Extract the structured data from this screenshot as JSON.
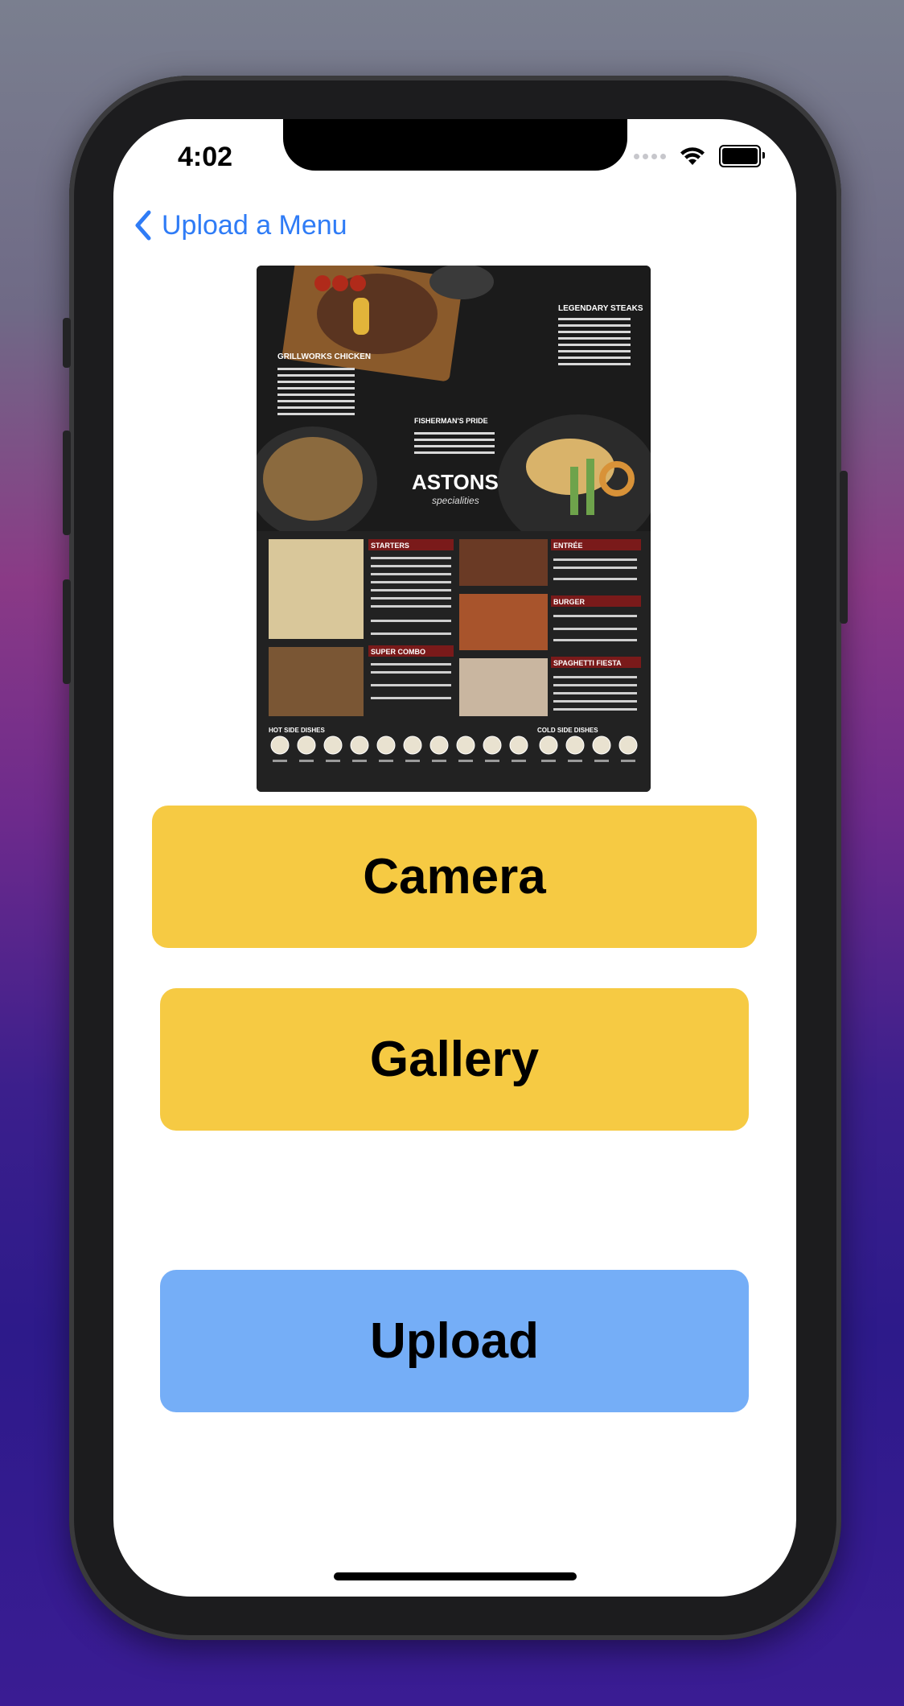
{
  "status_bar": {
    "time": "4:02"
  },
  "navigation": {
    "back_label": "Upload a Menu"
  },
  "menu_image": {
    "brand": "ASTONS",
    "brand_sub": "specialities",
    "sections": {
      "legendary_steaks": "LEGENDARY STEAKS",
      "grillworks_chicken": "GRILLWORKS CHICKEN",
      "fishermans_pride": "FISHERMAN'S PRIDE",
      "starters": "STARTERS",
      "entree": "ENTRÉE",
      "burger": "BURGER",
      "super_combo": "SUPER COMBO",
      "spaghetti_fiesta": "SPAGHETTI FIESTA",
      "hot_side_dishes": "HOT SIDE DISHES",
      "cold_side_dishes": "COLD SIDE DISHES"
    }
  },
  "buttons": {
    "camera": "Camera",
    "gallery": "Gallery",
    "upload": "Upload"
  },
  "colors": {
    "accent": "#2f7cf6",
    "camera_button": "#f6ca43",
    "gallery_button": "#f6ca43",
    "upload_button": "#75aef7"
  },
  "icons": {
    "back": "chevron-left-icon",
    "wifi": "wifi-icon",
    "battery": "battery-icon",
    "signal": "signal-icon"
  }
}
